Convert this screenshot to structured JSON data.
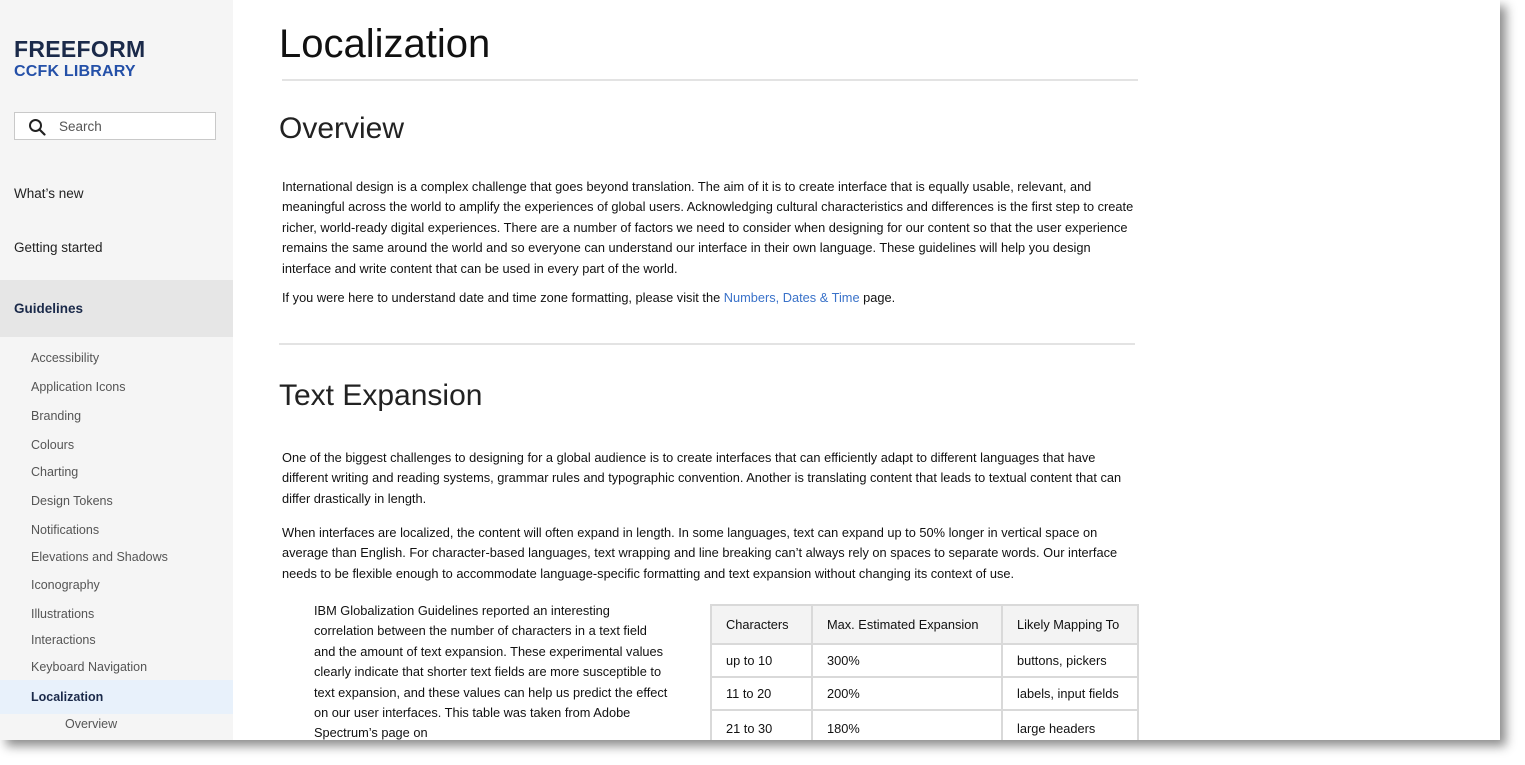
{
  "sidebar": {
    "brand_title": "FREEFORM",
    "brand_subtitle": "CCFK LIBRARY",
    "search_placeholder": "Search",
    "top_items": [
      "What’s new",
      "Getting started"
    ],
    "selected_section": "Guidelines",
    "sub_items": [
      "Accessibility",
      "Application Icons",
      "Branding",
      "Colours",
      "Charting",
      "Design Tokens",
      "Notifications",
      "Elevations and Shadows",
      "Iconography",
      "Illustrations",
      "Interactions",
      "Keyboard Navigation"
    ],
    "active_sub_item": "Localization",
    "active_sub_child": "Overview"
  },
  "main": {
    "title": "Localization",
    "overview": {
      "heading": "Overview",
      "paragraph": "International design is a complex challenge that goes beyond translation. The aim of it is to create interface that is equally usable, relevant, and meaningful across the world to amplify the experiences of global users. Acknowledging cultural characteristics and differences is the first step to create richer, world-ready digital experiences. There are a number of factors we need to consider when designing for our content so that the user experience remains the same around the world and so everyone can understand our interface in their own language. These guidelines will help you design interface and write content that can be used in every part of the world.",
      "visit_prefix": "If you were here to understand date and time zone formatting, please visit the ",
      "visit_link": "Numbers, Dates & Time",
      "visit_suffix": " page."
    },
    "text_expansion": {
      "heading": "Text Expansion",
      "paragraph1": "One of the biggest challenges to designing for a global audience is to create interfaces that can efficiently adapt to different languages that have different writing and reading systems, grammar rules and typographic convention. Another is translating content that leads to textual content that can differ drastically in length.",
      "paragraph2": "When interfaces are localized, the content will often expand in length. In some languages, text can expand up to 50% longer in vertical space on average than English. For character-based languages, text wrapping and line breaking can’t always rely on spaces to separate words. Our interface needs to be flexible enough to accommodate language-specific formatting and text expansion without changing its context of use.",
      "side_paragraph": "IBM Globalization Guidelines reported an interesting correlation between the number of characters in a text field and the amount of text expansion. These experimental values clearly indicate that shorter text fields are more susceptible to text expansion, and these values can help us predict the effect on our user interfaces. This table was taken from Adobe Spectrum’s page on",
      "table": {
        "headers": [
          "Characters",
          "Max. Estimated Expansion",
          "Likely Mapping To"
        ],
        "rows": [
          [
            "up to 10",
            "300%",
            "buttons, pickers"
          ],
          [
            "11 to 20",
            "200%",
            "labels, input fields"
          ],
          [
            "21 to 30",
            "180%",
            "large headers"
          ]
        ]
      }
    }
  },
  "colors": {
    "brand_title": "#1b2a4a",
    "brand_subtitle": "#2450a8",
    "link": "#3a72c9",
    "sidebar_bg": "#f5f5f5",
    "selected_bg": "#e6e6e6",
    "active_sub_bg": "#e8f1fb"
  }
}
